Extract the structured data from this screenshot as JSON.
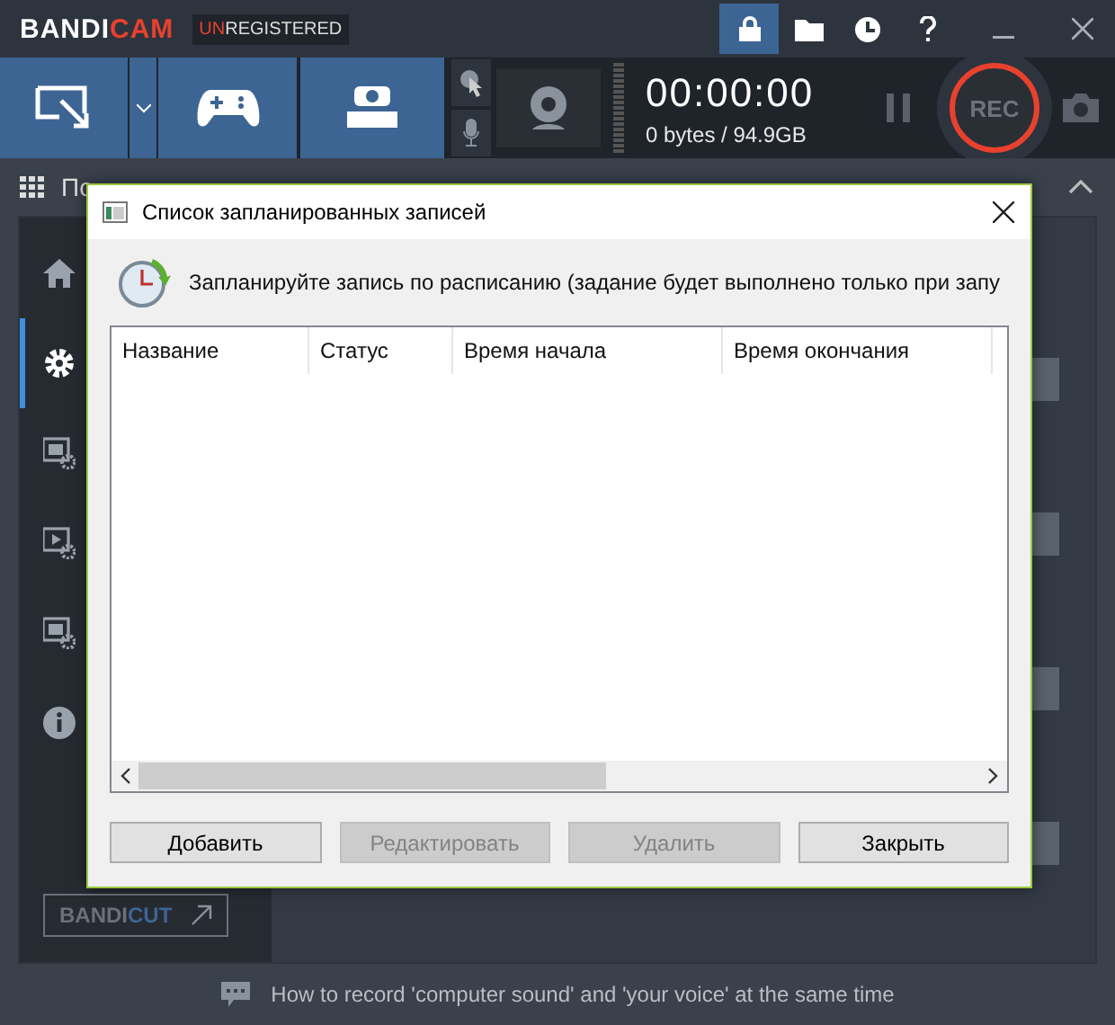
{
  "app": {
    "logo": {
      "part1": "BANDI",
      "part2": "CAM"
    },
    "license": {
      "part1": "UN",
      "part2": "REGISTERED"
    }
  },
  "top_tabs": [
    {
      "kind": "lock",
      "selected": true
    },
    {
      "kind": "folder",
      "selected": false
    },
    {
      "kind": "clock",
      "selected": false
    },
    {
      "kind": "help",
      "selected": false
    }
  ],
  "modes": [
    {
      "kind": "screen",
      "selected": true
    },
    {
      "kind": "game",
      "selected": true
    },
    {
      "kind": "hdmi",
      "selected": true
    }
  ],
  "recorder": {
    "timer": "00:00:00",
    "size": "0 bytes / 94.9GB",
    "rec_label": "REC"
  },
  "section": {
    "title": "По"
  },
  "sidebar": {
    "items": [
      {
        "kind": "home",
        "selected": false
      },
      {
        "kind": "gear",
        "selected": true
      },
      {
        "kind": "video",
        "selected": false
      },
      {
        "kind": "play",
        "selected": false
      },
      {
        "kind": "image",
        "selected": false
      },
      {
        "kind": "info",
        "selected": false
      }
    ]
  },
  "bandicut": {
    "part1": "BANDI",
    "part2": "CUT"
  },
  "dialog": {
    "title": "Список запланированных записей",
    "description": "Запланируйте запись по расписанию (задание будет выполнено только при запу",
    "table": {
      "columns": [
        "Название",
        "Статус",
        "Время начала",
        "Время окончания"
      ]
    },
    "buttons": [
      {
        "label": "Добавить",
        "disabled": false
      },
      {
        "label": "Редактировать",
        "disabled": true
      },
      {
        "label": "Удалить",
        "disabled": true
      },
      {
        "label": "Закрыть",
        "disabled": false
      }
    ]
  },
  "footer": {
    "tip": "How to record 'computer sound' and 'your voice' at the same time"
  }
}
